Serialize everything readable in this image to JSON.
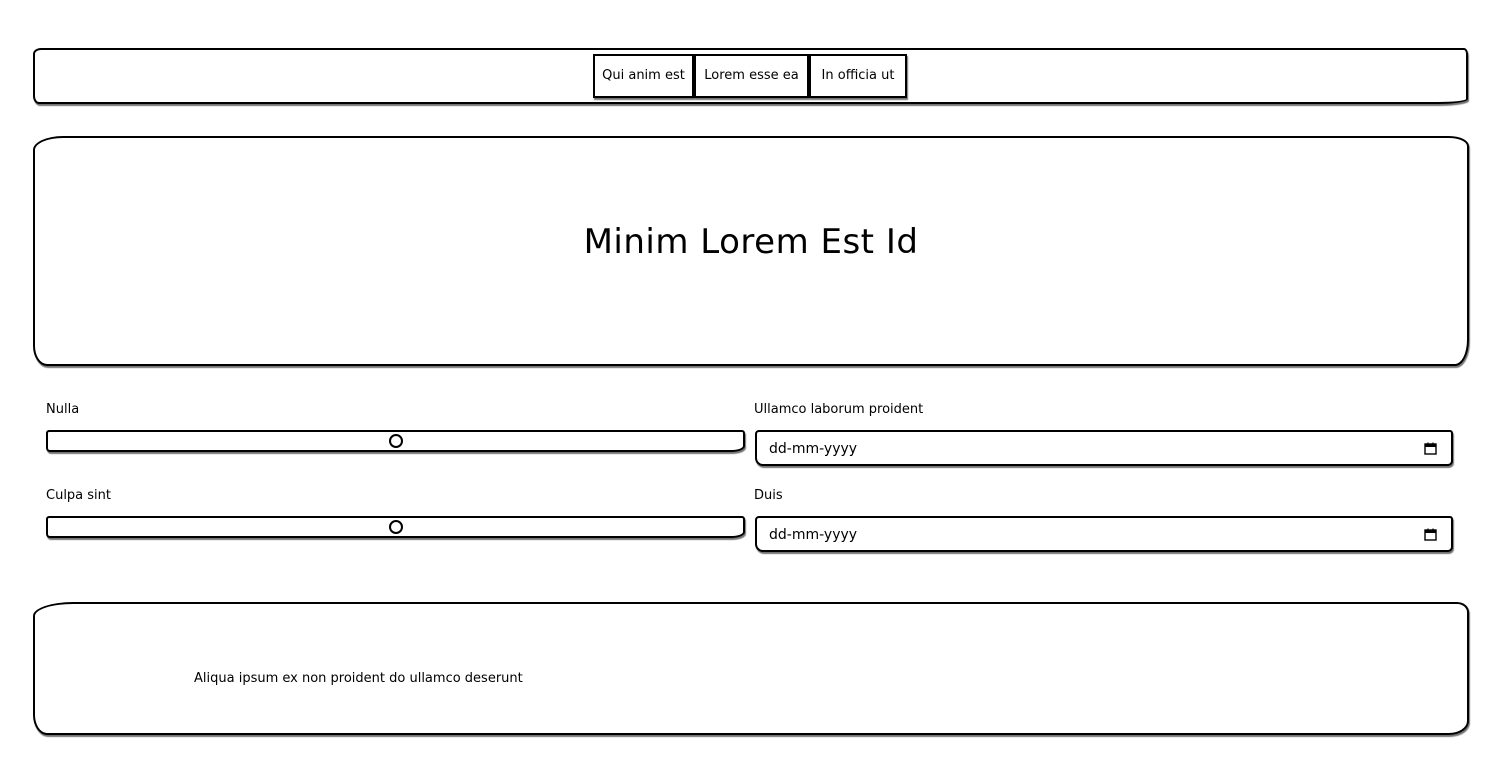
{
  "nav": {
    "items": [
      "Qui anim est",
      "Lorem esse ea",
      "In officia ut"
    ]
  },
  "hero": {
    "title": "Minim Lorem Est Id"
  },
  "form": {
    "nulla": {
      "label": "Nulla",
      "value_fraction": 0.5
    },
    "ullamco": {
      "label": "Ullamco laborum proident",
      "placeholder": "dd-mm-yyyy"
    },
    "culpa": {
      "label": "Culpa sint",
      "value_fraction": 0.5
    },
    "duis": {
      "label": "Duis",
      "placeholder": "dd-mm-yyyy"
    }
  },
  "footer": {
    "text": "Aliqua ipsum ex non proident do ullamco deserunt"
  },
  "icons": {
    "date_picker": "calendar-icon",
    "range_handle": "range-thumb"
  },
  "colors": {
    "border": "#000000",
    "background": "#ffffff"
  }
}
